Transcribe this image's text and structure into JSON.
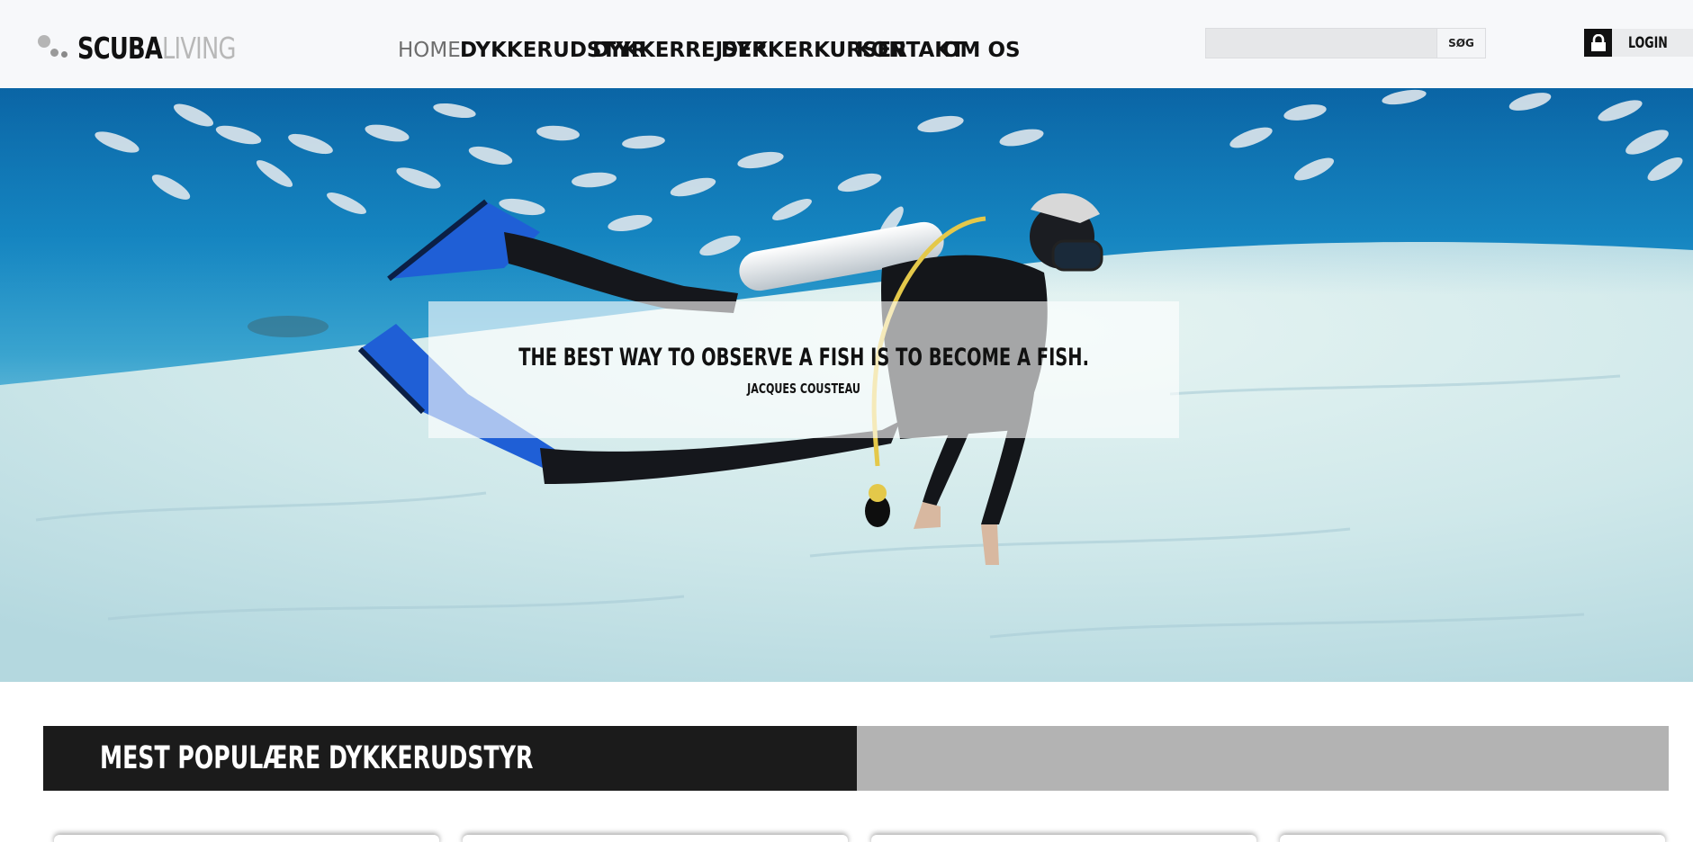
{
  "brand": {
    "part1": "SCUBA",
    "part2": "LIVING"
  },
  "nav": {
    "items": [
      {
        "label": "HOME",
        "active": true
      },
      {
        "label": "DYKKERUDSTYR",
        "active": false
      },
      {
        "label": "DYKKERREJSER",
        "active": false
      },
      {
        "label": "DYKKERKURSER",
        "active": false
      },
      {
        "label": "KONTAKT",
        "active": false
      },
      {
        "label": "OM OS",
        "active": false
      }
    ]
  },
  "search": {
    "value": "",
    "button_label": "SØG",
    "icon": "none"
  },
  "login": {
    "label": "LOGIN",
    "icon": "lock-icon"
  },
  "hero": {
    "quote": "THE BEST WAY TO OBSERVE A FISH IS TO BECOME A FISH.",
    "author": "JACQUES COUSTEAU"
  },
  "section": {
    "title": "MEST POPULÆRE DYKKERUDSTYR"
  },
  "colors": {
    "header_bg": "#f7f8fa",
    "text_dark": "#111111",
    "nav_active": "#6e6e6e",
    "section_dark": "#1b1b1b",
    "section_grey": "#b3b3b3",
    "water": "#1586c2",
    "fin_blue": "#1f5fd6"
  }
}
